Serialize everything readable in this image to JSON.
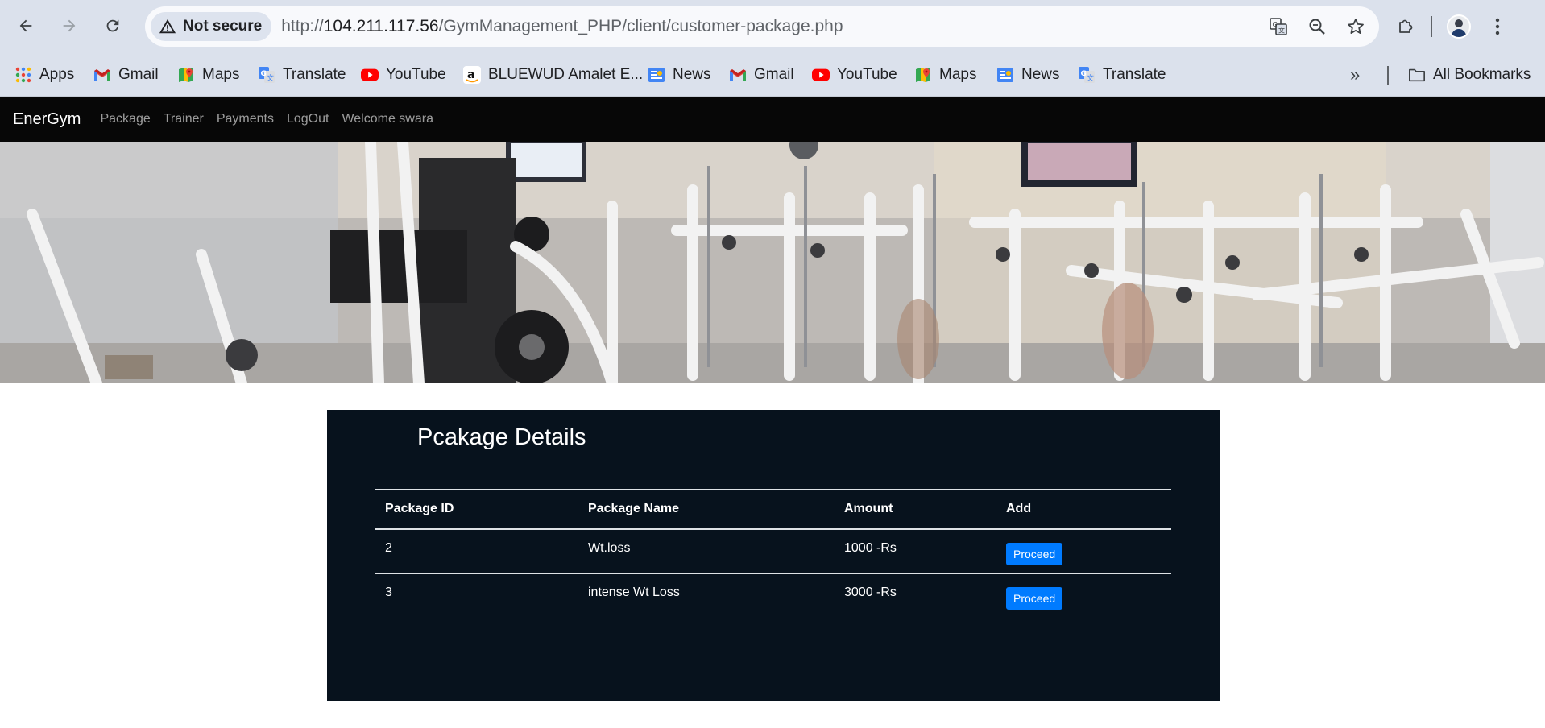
{
  "browser": {
    "security_label": "Not secure",
    "url_prefix": "http://",
    "url_host": "104.211.117.56",
    "url_path": "/GymManagement_PHP/client/customer-package.php"
  },
  "bookmarks": {
    "items": [
      {
        "label": "Apps",
        "icon": "apps-grid-icon"
      },
      {
        "label": "Gmail",
        "icon": "gmail-icon"
      },
      {
        "label": "Maps",
        "icon": "maps-icon"
      },
      {
        "label": "Translate",
        "icon": "translate-icon"
      },
      {
        "label": "YouTube",
        "icon": "youtube-icon"
      },
      {
        "label": "BLUEWUD Amalet E...",
        "icon": "amazon-icon"
      },
      {
        "label": "News",
        "icon": "news-icon"
      },
      {
        "label": "Gmail",
        "icon": "gmail-icon"
      },
      {
        "label": "YouTube",
        "icon": "youtube-icon"
      },
      {
        "label": "Maps",
        "icon": "maps-icon"
      },
      {
        "label": "News",
        "icon": "news-icon"
      },
      {
        "label": "Translate",
        "icon": "translate-icon"
      }
    ],
    "all_bookmarks": "All Bookmarks"
  },
  "site": {
    "brand": "EnerGym",
    "nav": [
      "Package",
      "Trainer",
      "Payments",
      "LogOut",
      "Welcome swara"
    ]
  },
  "packages": {
    "title": "Pcakage Details",
    "columns": [
      "Package ID",
      "Package Name",
      "Amount",
      "Add"
    ],
    "rows": [
      {
        "id": "2",
        "name": "Wt.loss",
        "amount": "1000 -Rs",
        "action": "Proceed"
      },
      {
        "id": "3",
        "name": "intense Wt Loss",
        "amount": "3000 -Rs",
        "action": "Proceed"
      }
    ]
  },
  "colors": {
    "nav_bg": "#070707",
    "panel_bg": "#07121d",
    "button": "#007bff"
  }
}
